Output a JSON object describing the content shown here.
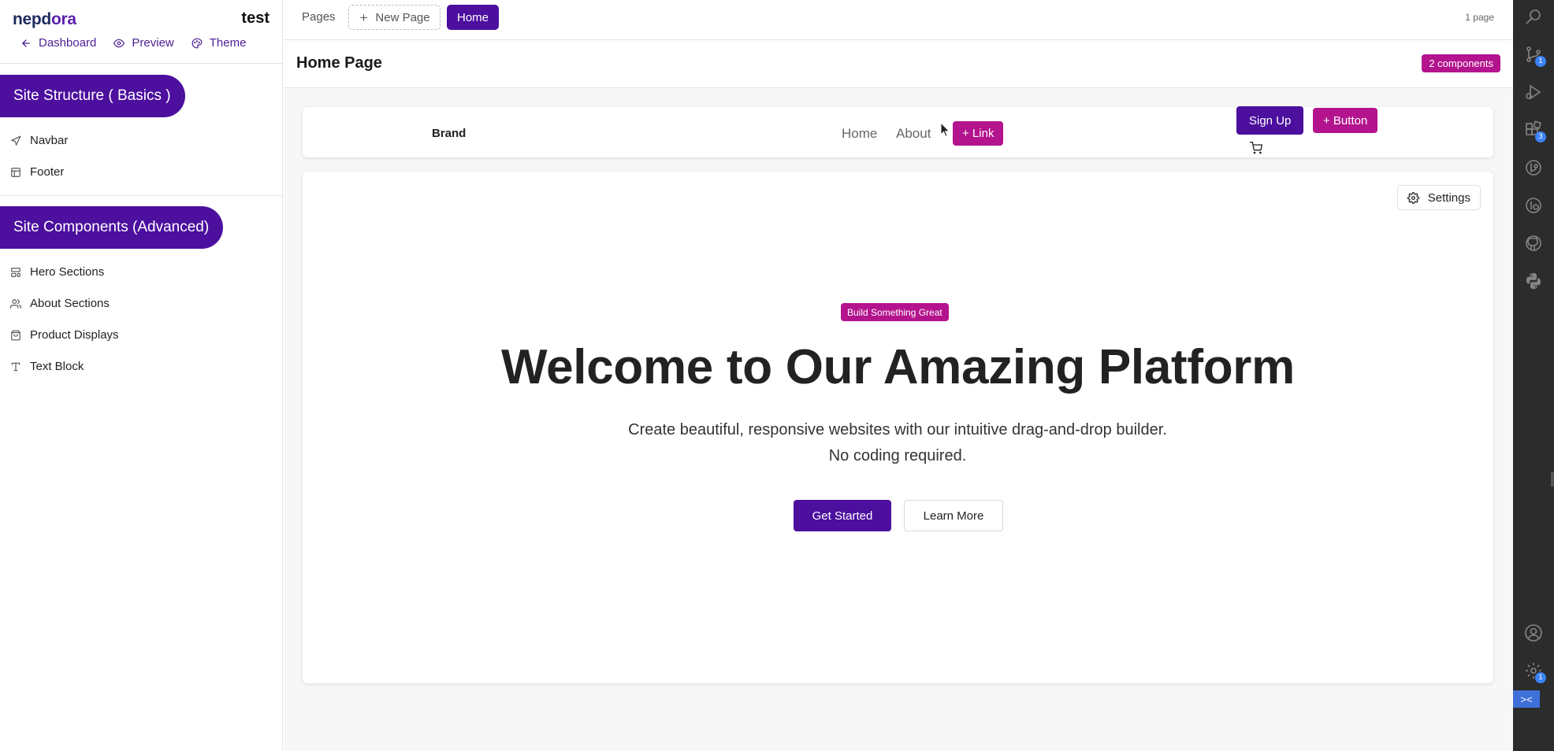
{
  "sidebar": {
    "logo_text_a": "nepd",
    "logo_text_b": "ora",
    "site_name": "test",
    "links": [
      {
        "label": "Dashboard",
        "icon": "arrow-left-icon"
      },
      {
        "label": "Preview",
        "icon": "eye-icon"
      },
      {
        "label": "Theme",
        "icon": "palette-icon"
      }
    ],
    "sections": [
      {
        "title": "Site Structure ( Basics )",
        "items": [
          {
            "label": "Navbar",
            "icon": "send-icon"
          },
          {
            "label": "Footer",
            "icon": "layout-icon"
          }
        ]
      },
      {
        "title": "Site Components (Advanced)",
        "items": [
          {
            "label": "Hero Sections",
            "icon": "layout-template-icon"
          },
          {
            "label": "About Sections",
            "icon": "users-icon"
          },
          {
            "label": "Product Displays",
            "icon": "shopping-bag-icon"
          },
          {
            "label": "Text Block",
            "icon": "type-icon"
          }
        ]
      }
    ]
  },
  "topbar": {
    "pages_label": "Pages",
    "new_page_label": "New Page",
    "active_page_label": "Home",
    "page_count": "1 page"
  },
  "pagehead": {
    "title": "Home Page",
    "components_badge": "2 components"
  },
  "navbar": {
    "brand": "Brand",
    "links": [
      "Home",
      "About"
    ],
    "add_link_label": "+ Link",
    "signup_label": "Sign Up",
    "add_button_label": "+ Button"
  },
  "hero": {
    "settings_label": "Settings",
    "badge": "Build Something Great",
    "title": "Welcome to Our Amazing Platform",
    "subtitle": "Create beautiful, responsive websites with our intuitive drag-and-drop builder. No coding required.",
    "primary_cta": "Get Started",
    "secondary_cta": "Learn More"
  },
  "activitybar": {
    "icons": [
      {
        "name": "search-icon"
      },
      {
        "name": "source-control-icon",
        "badge": "1"
      },
      {
        "name": "run-debug-icon"
      },
      {
        "name": "extensions-icon",
        "badge": "3"
      },
      {
        "name": "git-lens-icon"
      },
      {
        "name": "git-history-icon"
      },
      {
        "name": "github-icon"
      },
      {
        "name": "python-icon"
      },
      {
        "name": "account-icon"
      },
      {
        "name": "manage-gear-icon",
        "badge": "1"
      }
    ],
    "remote_label": "><"
  },
  "colors": {
    "primary": "#4c0f9e",
    "accent": "#b3138d",
    "activitybar_bg": "#2c2c2c"
  }
}
